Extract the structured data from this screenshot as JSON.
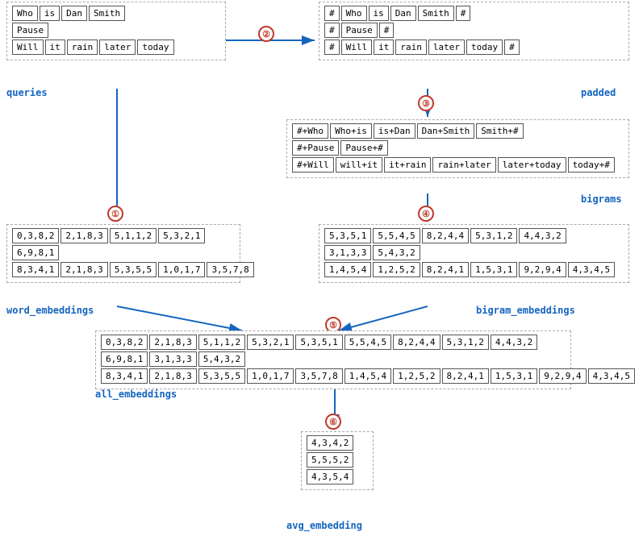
{
  "queries": {
    "label": "queries",
    "rows": [
      [
        "Who",
        "is",
        "Dan",
        "Smith"
      ],
      [
        "Pause"
      ],
      [
        "Will",
        "it",
        "rain",
        "later",
        "today"
      ]
    ]
  },
  "padded": {
    "label": "padded",
    "rows": [
      [
        "#",
        "Who",
        "is",
        "Dan",
        "Smith",
        "#"
      ],
      [
        "#",
        "Pause",
        "#"
      ],
      [
        "#",
        "Will",
        "it",
        "rain",
        "later",
        "today",
        "#"
      ]
    ]
  },
  "bigrams": {
    "label": "bigrams",
    "rows": [
      [
        "#+Who",
        "Who+is",
        "is+Dan",
        "Dan+Smith",
        "Smith+#"
      ],
      [
        "#+Pause",
        "Pause+#"
      ],
      [
        "#+Will",
        "will+it",
        "it+rain",
        "rain+later",
        "later+today",
        "today+#"
      ]
    ]
  },
  "word_embeddings": {
    "label": "word_embeddings",
    "rows": [
      [
        "0,3,8,2",
        "2,1,8,3",
        "5,1,1,2",
        "5,3,2,1"
      ],
      [
        "6,9,8,1"
      ],
      [
        "8,3,4,1",
        "2,1,8,3",
        "5,3,5,5",
        "1,0,1,7",
        "3,5,7,8"
      ]
    ]
  },
  "bigram_embeddings": {
    "label": "bigram_embeddings",
    "rows": [
      [
        "5,3,5,1",
        "5,5,4,5",
        "8,2,4,4",
        "5,3,1,2",
        "4,4,3,2"
      ],
      [
        "3,1,3,3",
        "5,4,3,2"
      ],
      [
        "1,4,5,4",
        "1,2,5,2",
        "8,2,4,1",
        "1,5,3,1",
        "9,2,9,4",
        "4,3,4,5"
      ]
    ]
  },
  "all_embeddings": {
    "label": "all_embeddings",
    "rows": [
      [
        "0,3,8,2",
        "2,1,8,3",
        "5,1,1,2",
        "5,3,2,1",
        "5,3,5,1",
        "5,5,4,5",
        "8,2,4,4",
        "5,3,1,2",
        "4,4,3,2"
      ],
      [
        "6,9,8,1",
        "3,1,3,3",
        "5,4,3,2"
      ],
      [
        "8,3,4,1",
        "2,1,8,3",
        "5,3,5,5",
        "1,0,1,7",
        "3,5,7,8",
        "1,4,5,4",
        "1,2,5,2",
        "8,2,4,1",
        "1,5,3,1",
        "9,2,9,4",
        "4,3,4,5"
      ]
    ]
  },
  "avg_embedding": {
    "label": "avg_embedding",
    "rows": [
      [
        "4,3,4,2"
      ],
      [
        "5,5,5,2"
      ],
      [
        "4,3,5,4"
      ]
    ]
  },
  "step_labels": {
    "s1": "①",
    "s2": "②",
    "s3": "③",
    "s4": "④",
    "s5": "⑤",
    "s6": "⑥"
  }
}
